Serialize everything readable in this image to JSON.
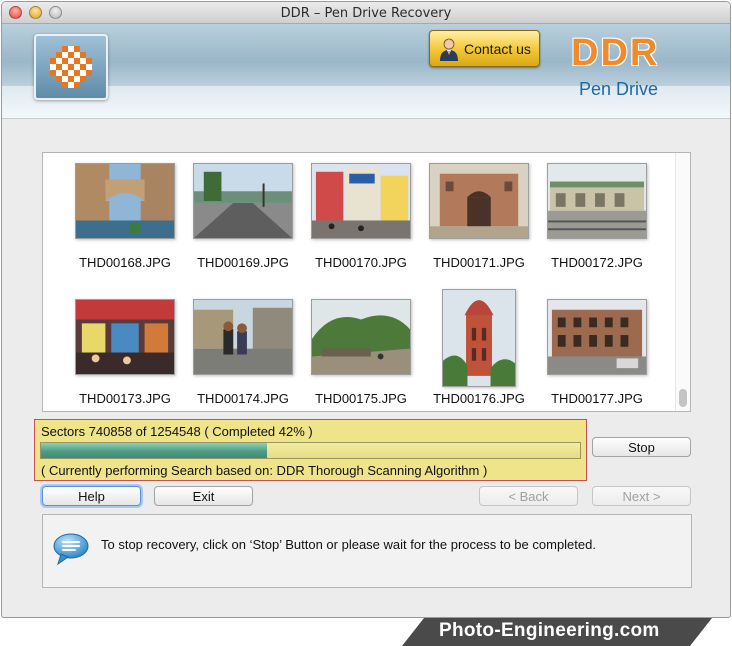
{
  "window": {
    "title": "DDR – Pen Drive Recovery"
  },
  "banner": {
    "contact_label": "Contact us",
    "brand_name": "DDR",
    "brand_sub": "Pen Drive",
    "brand_color": "#f08a2a",
    "sub_color": "#1e67a8"
  },
  "thumbnails": [
    {
      "file": "THD00168.JPG",
      "scene": "bridge"
    },
    {
      "file": "THD00169.JPG",
      "scene": "lake"
    },
    {
      "file": "THD00170.JPG",
      "scene": "street"
    },
    {
      "file": "THD00171.JPG",
      "scene": "fort"
    },
    {
      "file": "THD00172.JPG",
      "scene": "station"
    },
    {
      "file": "THD00173.JPG",
      "scene": "market"
    },
    {
      "file": "THD00174.JPG",
      "scene": "people"
    },
    {
      "file": "THD00175.JPG",
      "scene": "hill"
    },
    {
      "file": "THD00176.JPG",
      "scene": "tower"
    },
    {
      "file": "THD00177.JPG",
      "scene": "building"
    }
  ],
  "progress": {
    "sectors_text": "Sectors 740858 of 1254548    ( Completed 42% )",
    "percent": 42,
    "status_text": "( Currently performing Search based on: DDR Thorough Scanning Algorithm )",
    "fill_color": "#4f9c86"
  },
  "buttons": {
    "stop": "Stop",
    "help": "Help",
    "exit": "Exit",
    "back": "< Back",
    "next": "Next >"
  },
  "info": {
    "message": "To stop recovery, click on ‘Stop’ Button or please wait for the process to be completed.",
    "icon": "speech-bubble-icon"
  },
  "watermark": {
    "text": "Photo-Engineering.com"
  }
}
